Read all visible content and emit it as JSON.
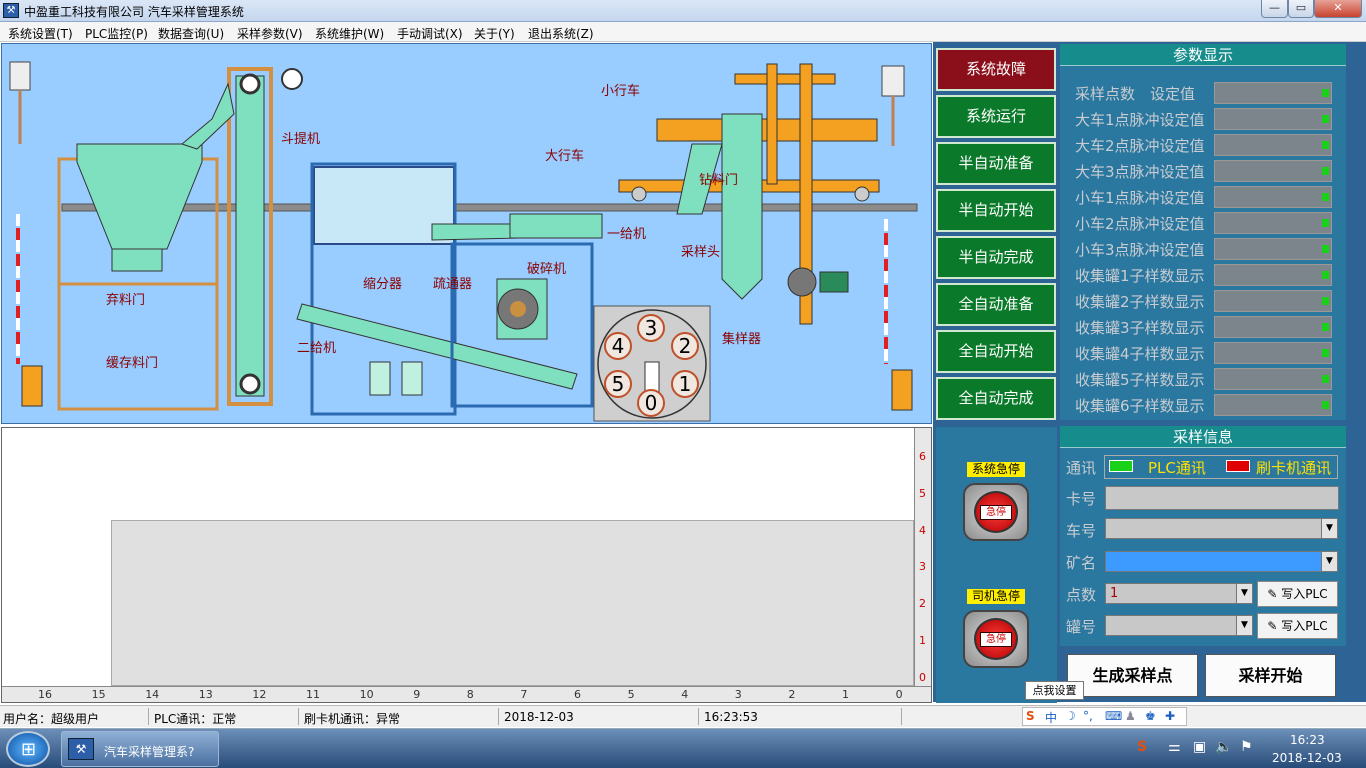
{
  "window": {
    "title": "中盈重工科技有限公司 汽车采样管理系统",
    "min": "—",
    "max": "▭",
    "close": "✕"
  },
  "menu": [
    "系统设置(T)",
    "PLC监控(P)",
    "数据查询(U)",
    "采样参数(V)",
    "系统维护(W)",
    "手动调试(X)",
    "关于(Y)",
    "退出系统(Z)"
  ],
  "scene": {
    "labels": {
      "bucket_elevator": "斗提机",
      "small_cart": "小行车",
      "big_cart": "大行车",
      "drill": "钻料门",
      "feeder1": "一给机",
      "sampling_head": "采样头",
      "crusher": "破碎机",
      "divider": "缩分器",
      "unblocker": "疏通器",
      "collector": "集样器",
      "discard_gate": "弃料门",
      "storage_gate": "缓存料门",
      "feeder2": "二给机"
    },
    "carousel": [
      "3",
      "2",
      "1",
      "0",
      "5",
      "4"
    ]
  },
  "status_buttons": [
    "系统故障",
    "系统运行",
    "半自动准备",
    "半自动开始",
    "半自动完成",
    "全自动准备",
    "全自动开始",
    "全自动完成"
  ],
  "param_panel": {
    "title": "参数显示",
    "rows": [
      "采样点数　设定值",
      "大车1点脉冲设定值",
      "大车2点脉冲设定值",
      "大车3点脉冲设定值",
      "小车1点脉冲设定值",
      "小车2点脉冲设定值",
      "小车3点脉冲设定值",
      "收集罐1子样数显示",
      "收集罐2子样数显示",
      "收集罐3子样数显示",
      "收集罐4子样数显示",
      "收集罐5子样数显示",
      "收集罐6子样数显示"
    ]
  },
  "estop": {
    "system": "系统急停",
    "driver": "司机急停",
    "button": "急停"
  },
  "sampling_info": {
    "title": "采样信息",
    "comm_label": "通讯",
    "plc_comm": "PLC通讯",
    "card_comm": "刷卡机通讯",
    "card_label": "卡号",
    "car_label": "车号",
    "ore_label": "矿名",
    "points_label": "点数",
    "points_value": "1",
    "tank_label": "罐号",
    "write_plc": "写入PLC",
    "colors": {
      "plc": "#19d119",
      "card": "#e00000"
    }
  },
  "actions": {
    "generate": "生成采样点",
    "start": "采样开始"
  },
  "tooltip": "点我设置",
  "chart": {
    "x_ticks": [
      "16",
      "15",
      "14",
      "13",
      "12",
      "11",
      "10",
      "9",
      "8",
      "7",
      "6",
      "5",
      "4",
      "3",
      "2",
      "1",
      "0"
    ],
    "y_ticks": [
      "6",
      "5",
      "4",
      "3",
      "2",
      "1",
      "0"
    ]
  },
  "statusbar": {
    "user": "用户名：超级用户",
    "plc": "PLC通讯：正常",
    "card": "刷卡机通讯：异常",
    "date": "2018-12-03",
    "time": "16:23:53"
  },
  "ime": [
    "中",
    "☽",
    "°,",
    "⌨",
    "♟",
    "♚",
    "✚"
  ],
  "taskbar": {
    "task": "汽车采样管理系?",
    "clock_time": "16:23",
    "clock_date": "2018-12-03"
  }
}
